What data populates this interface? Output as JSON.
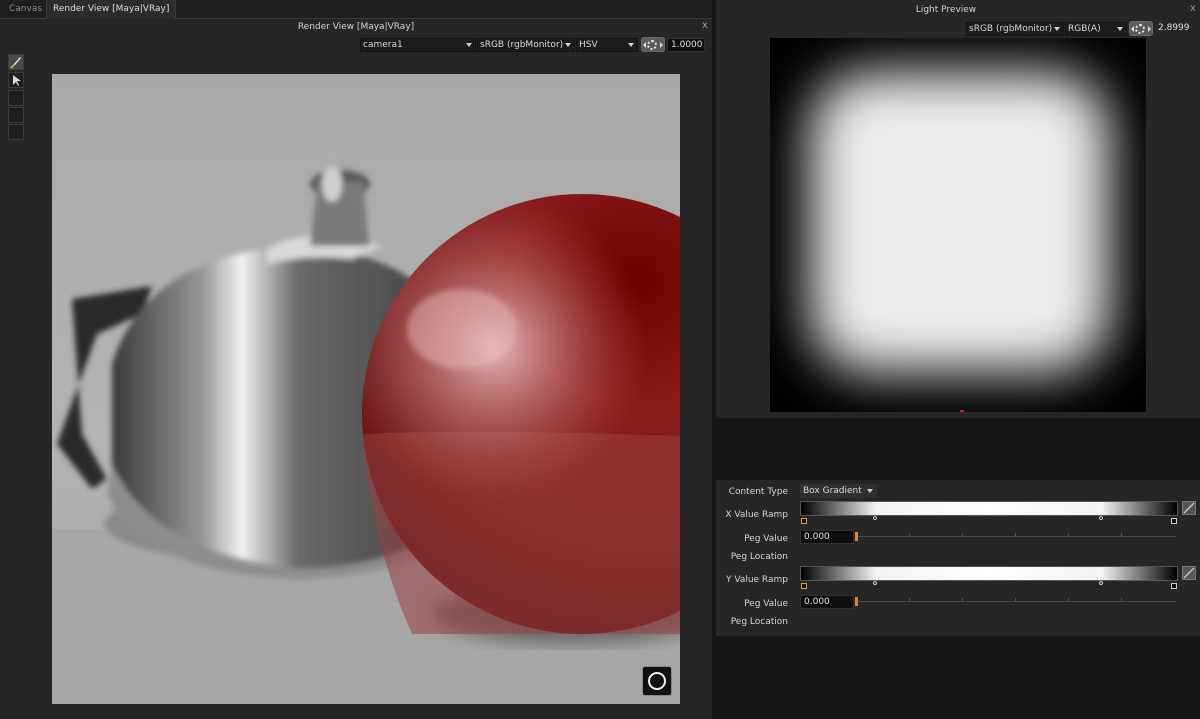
{
  "tabs": [
    {
      "label": "Canvas",
      "active": false
    },
    {
      "label": "Render View [Maya|VRay]",
      "active": true
    }
  ],
  "render_view": {
    "title": "Render View [Maya|VRay]",
    "camera": "camera1",
    "colorspace": "sRGB (rgbMonitor)",
    "display_mode": "HSV",
    "exposure": "1.0000"
  },
  "light_preview": {
    "title": "Light Preview",
    "colorspace": "sRGB (rgbMonitor)",
    "channels": "RGB(A)",
    "exposure": "2.8999"
  },
  "properties": {
    "content_type_label": "Content Type",
    "content_type_value": "Box Gradient",
    "x_ramp_label": "X Value Ramp",
    "y_ramp_label": "Y Value Ramp",
    "peg_value_label": "Peg Value",
    "peg_location_label": "Peg Location",
    "x_peg_value": "0.000",
    "y_peg_value": "0.000"
  },
  "icons": [
    "paintbrush-icon",
    "pointer-icon",
    "close-icon",
    "exposure-icon",
    "vray-logo-icon",
    "curve-icon",
    "chevron-down-icon"
  ],
  "colors": {
    "accent": "#e8802a",
    "panel": "#262626",
    "background": "#161616"
  }
}
